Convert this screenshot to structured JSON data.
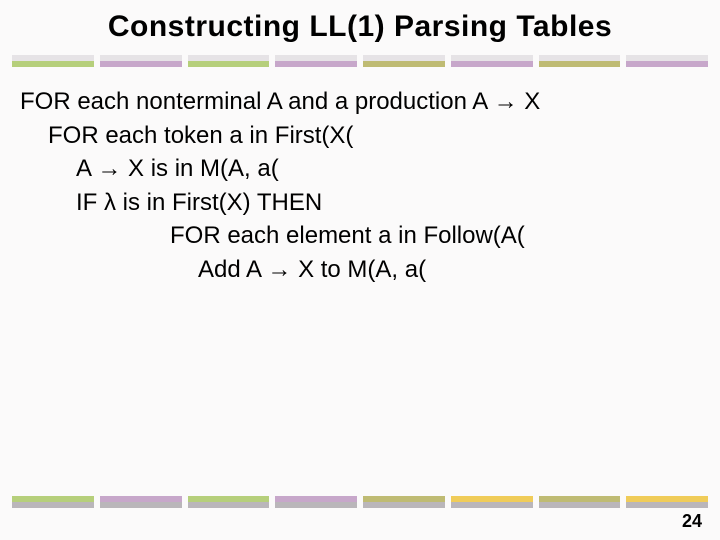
{
  "title": "Constructing LL(1) Parsing Tables",
  "lines": {
    "l0": "FOR each nonterminal A and a production A → X",
    "l1": "FOR each token a in First(X(",
    "l2": "A → X is in M(A, a(",
    "l3": "IF λ is in First(X) THEN",
    "l4": "FOR each element a in Follow(A(",
    "l5": "Add A → X to M(A, a("
  },
  "page_number": "24",
  "band_colors": {
    "top_light": [
      "green",
      "mauve",
      "green",
      "mauve",
      "olive",
      "mauve",
      "olive",
      "mauve"
    ],
    "bottom_dark": [
      "green",
      "mauve",
      "green",
      "mauve",
      "olive",
      "yellow",
      "olive",
      "yellow"
    ]
  }
}
